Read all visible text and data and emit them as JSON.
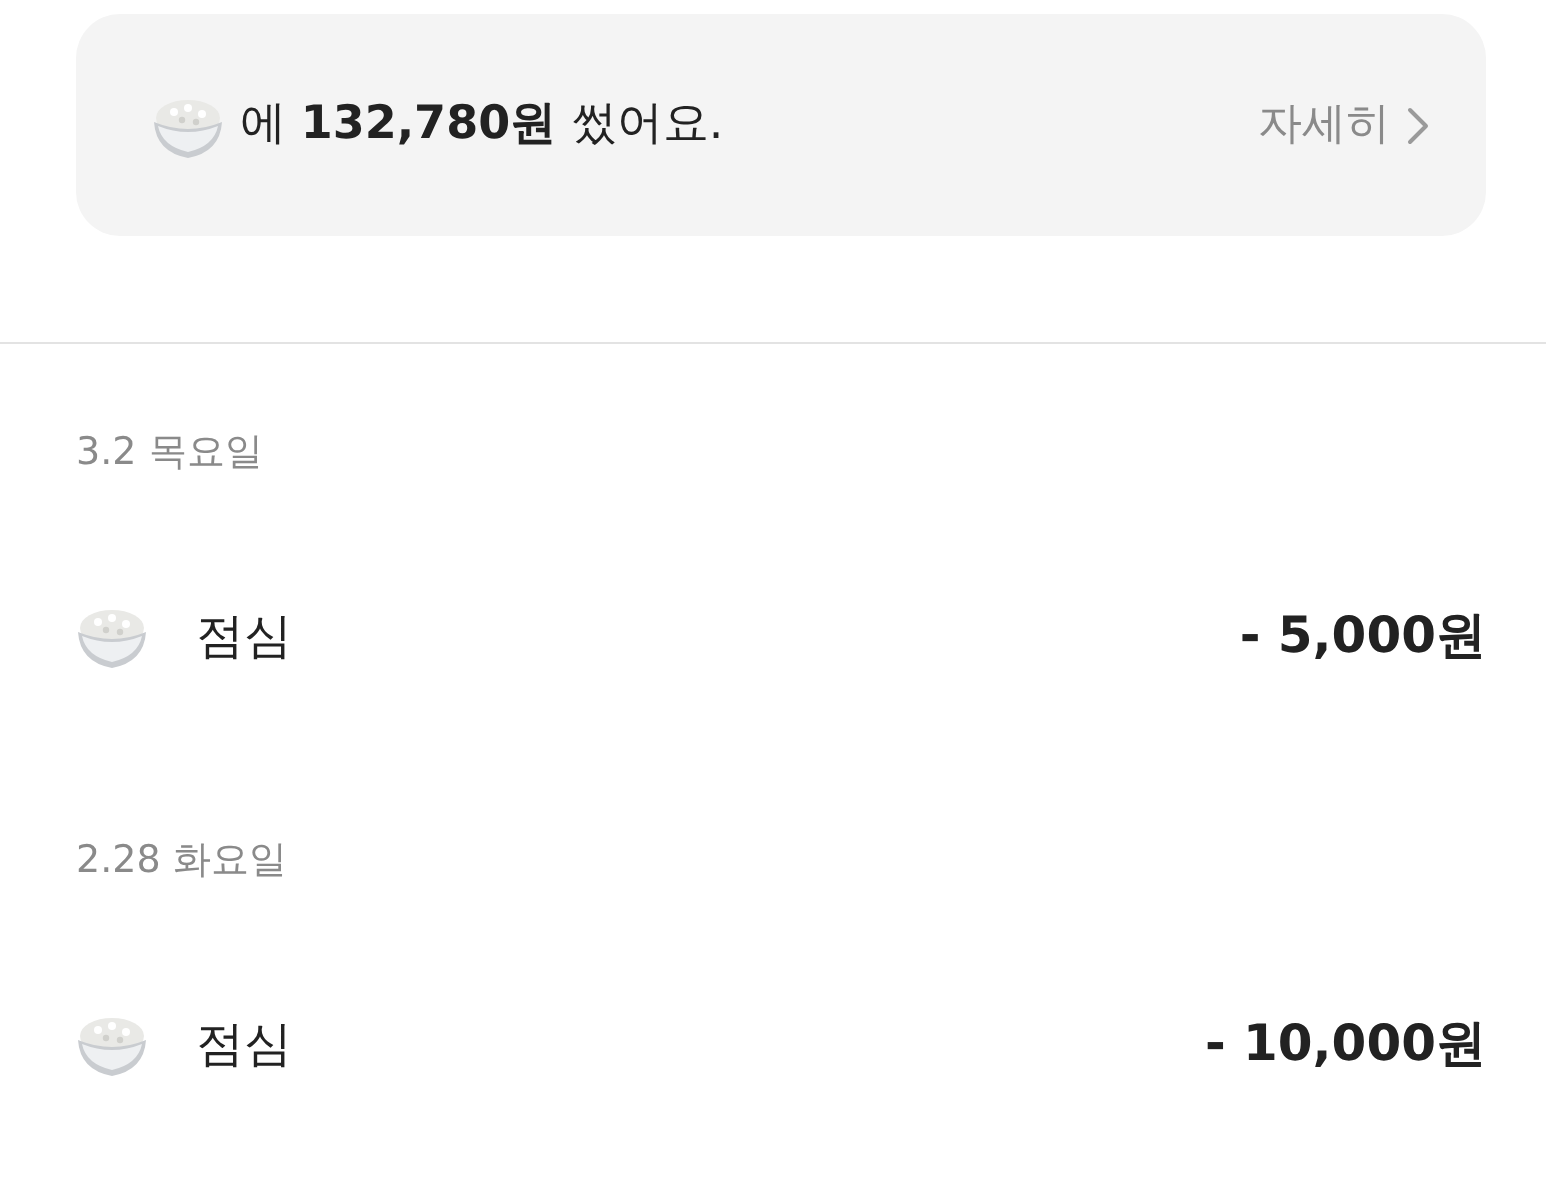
{
  "summary": {
    "text": "에 **132,780원** 썼어요.",
    "detail_link": "자세히"
  },
  "days": [
    {
      "date": "3.2 목요일",
      "items": [
        {
          "title": "점심",
          "amount": "- 5,000원"
        }
      ]
    },
    {
      "date": "2.28 화요일",
      "items": [
        {
          "title": "점심",
          "amount": "- 10,000원"
        }
      ]
    }
  ]
}
